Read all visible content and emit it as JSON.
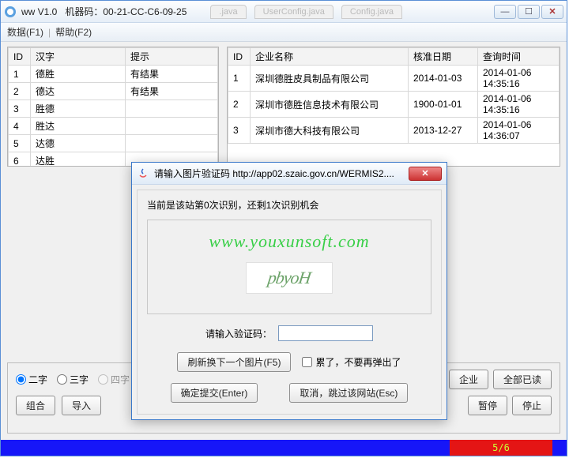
{
  "window": {
    "title": "ww V1.0",
    "machine_label": "机器码：00-21-CC-C6-09-25",
    "bg_tabs": [
      ".java",
      "UserConfig.java",
      "Config.java"
    ]
  },
  "menu": {
    "data": "数据(F1)",
    "help": "帮助(F2)"
  },
  "left_table": {
    "headers": [
      "ID",
      "汉字",
      "提示"
    ],
    "rows": [
      [
        "1",
        "德胜",
        "有结果"
      ],
      [
        "2",
        "德达",
        "有结果"
      ],
      [
        "3",
        "胜德",
        ""
      ],
      [
        "4",
        "胜达",
        ""
      ],
      [
        "5",
        "达德",
        ""
      ],
      [
        "6",
        "达胜",
        ""
      ]
    ]
  },
  "right_table": {
    "headers": [
      "ID",
      "企业名称",
      "核准日期",
      "查询时间"
    ],
    "rows": [
      [
        "1",
        "深圳德胜皮具制品有限公司",
        "2014-01-03",
        "2014-01-06 14:35:16"
      ],
      [
        "2",
        "深圳市德胜信息技术有限公司",
        "1900-01-01",
        "2014-01-06 14:35:16"
      ],
      [
        "3",
        "深圳市德大科技有限公司",
        "2013-12-27",
        "2014-01-06 14:36:07"
      ]
    ]
  },
  "controls": {
    "radios": {
      "two": "二字",
      "three": "三字",
      "four": "四字"
    },
    "combine": "组合",
    "import": "导入",
    "right_buttons": {
      "all_company": "企业",
      "all_read": "全部已读",
      "pause": "暂停",
      "stop": "停止"
    }
  },
  "dialog": {
    "title": "请输入图片验证码 http://app02.szaic.gov.cn/WERMIS2....",
    "message": "当前是该站第0次识别，还剩1次识别机会",
    "watermark": "www.youxunsoft.com",
    "captcha_text": "pbyoH",
    "input_label": "请输入验证码：",
    "refresh": "刷新换下一个图片(F5)",
    "checkbox": "累了，不要再弹出了",
    "ok": "确定提交(Enter)",
    "cancel": "取消，跳过该网站(Esc)"
  },
  "status": {
    "progress": "5/6"
  }
}
